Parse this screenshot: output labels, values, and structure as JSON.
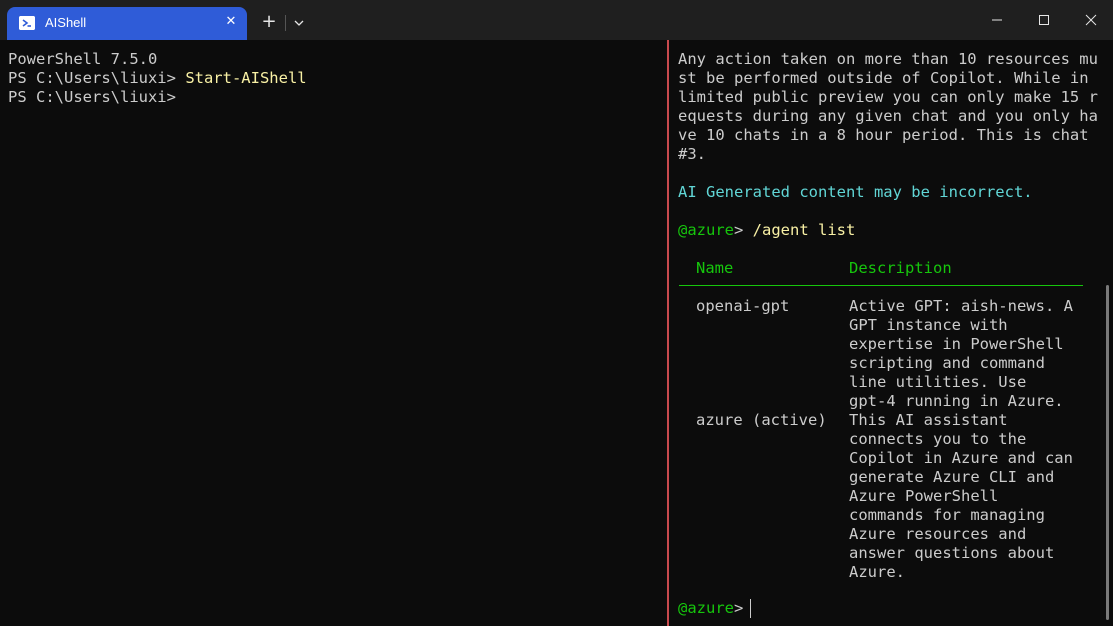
{
  "window": {
    "tab_title": "AIShell",
    "new_tab_label": "+",
    "close_tab_label": "✕"
  },
  "left_pane": {
    "line1": "PowerShell 7.5.0",
    "line2_prompt": "PS C:\\Users\\liuxi> ",
    "line2_command": "Start-AIShell",
    "line3_prompt": "PS C:\\Users\\liuxi>"
  },
  "right_pane": {
    "intro_lines": [
      "Any action taken on more than 10 resources mu",
      "st be performed outside of Copilot. While in",
      "limited public preview you can only make 15 r",
      "equests during any given chat and you only ha",
      "ve 10 chats in a 8 hour period. This is chat",
      "#3."
    ],
    "disclaimer": "AI Generated content may be incorrect.",
    "prompt_agent": "@azure",
    "prompt_symbol": "> ",
    "command": "/agent list",
    "table": {
      "headers": [
        "Name",
        "Description"
      ],
      "rows": [
        {
          "name": "openai-gpt",
          "description": [
            "Active GPT: aish-news. A",
            "GPT instance with",
            "expertise in PowerShell",
            "scripting and command",
            "line utilities. Use",
            "gpt-4 running in Azure."
          ]
        },
        {
          "name": "azure (active)",
          "description": [
            "This AI assistant",
            "connects you to the",
            "Copilot in Azure and can",
            "generate Azure CLI and",
            "Azure PowerShell",
            "commands for managing",
            "Azure resources and",
            "answer questions about",
            "Azure."
          ]
        }
      ]
    },
    "final_prompt_agent": "@azure",
    "final_prompt_symbol": ">"
  },
  "colors": {
    "background": "#0c0c0c",
    "tab_active": "#2f5cd8",
    "pane_divider": "#c94a4e",
    "prompt_green": "#16c60c",
    "command_yellow": "#f9f1a5",
    "disclaimer_cyan": "#61d6d6"
  },
  "icons": [
    "powershell-icon",
    "close-icon",
    "plus-icon",
    "chevron-down-icon",
    "minimize-icon",
    "maximize-icon",
    "window-close-icon"
  ]
}
